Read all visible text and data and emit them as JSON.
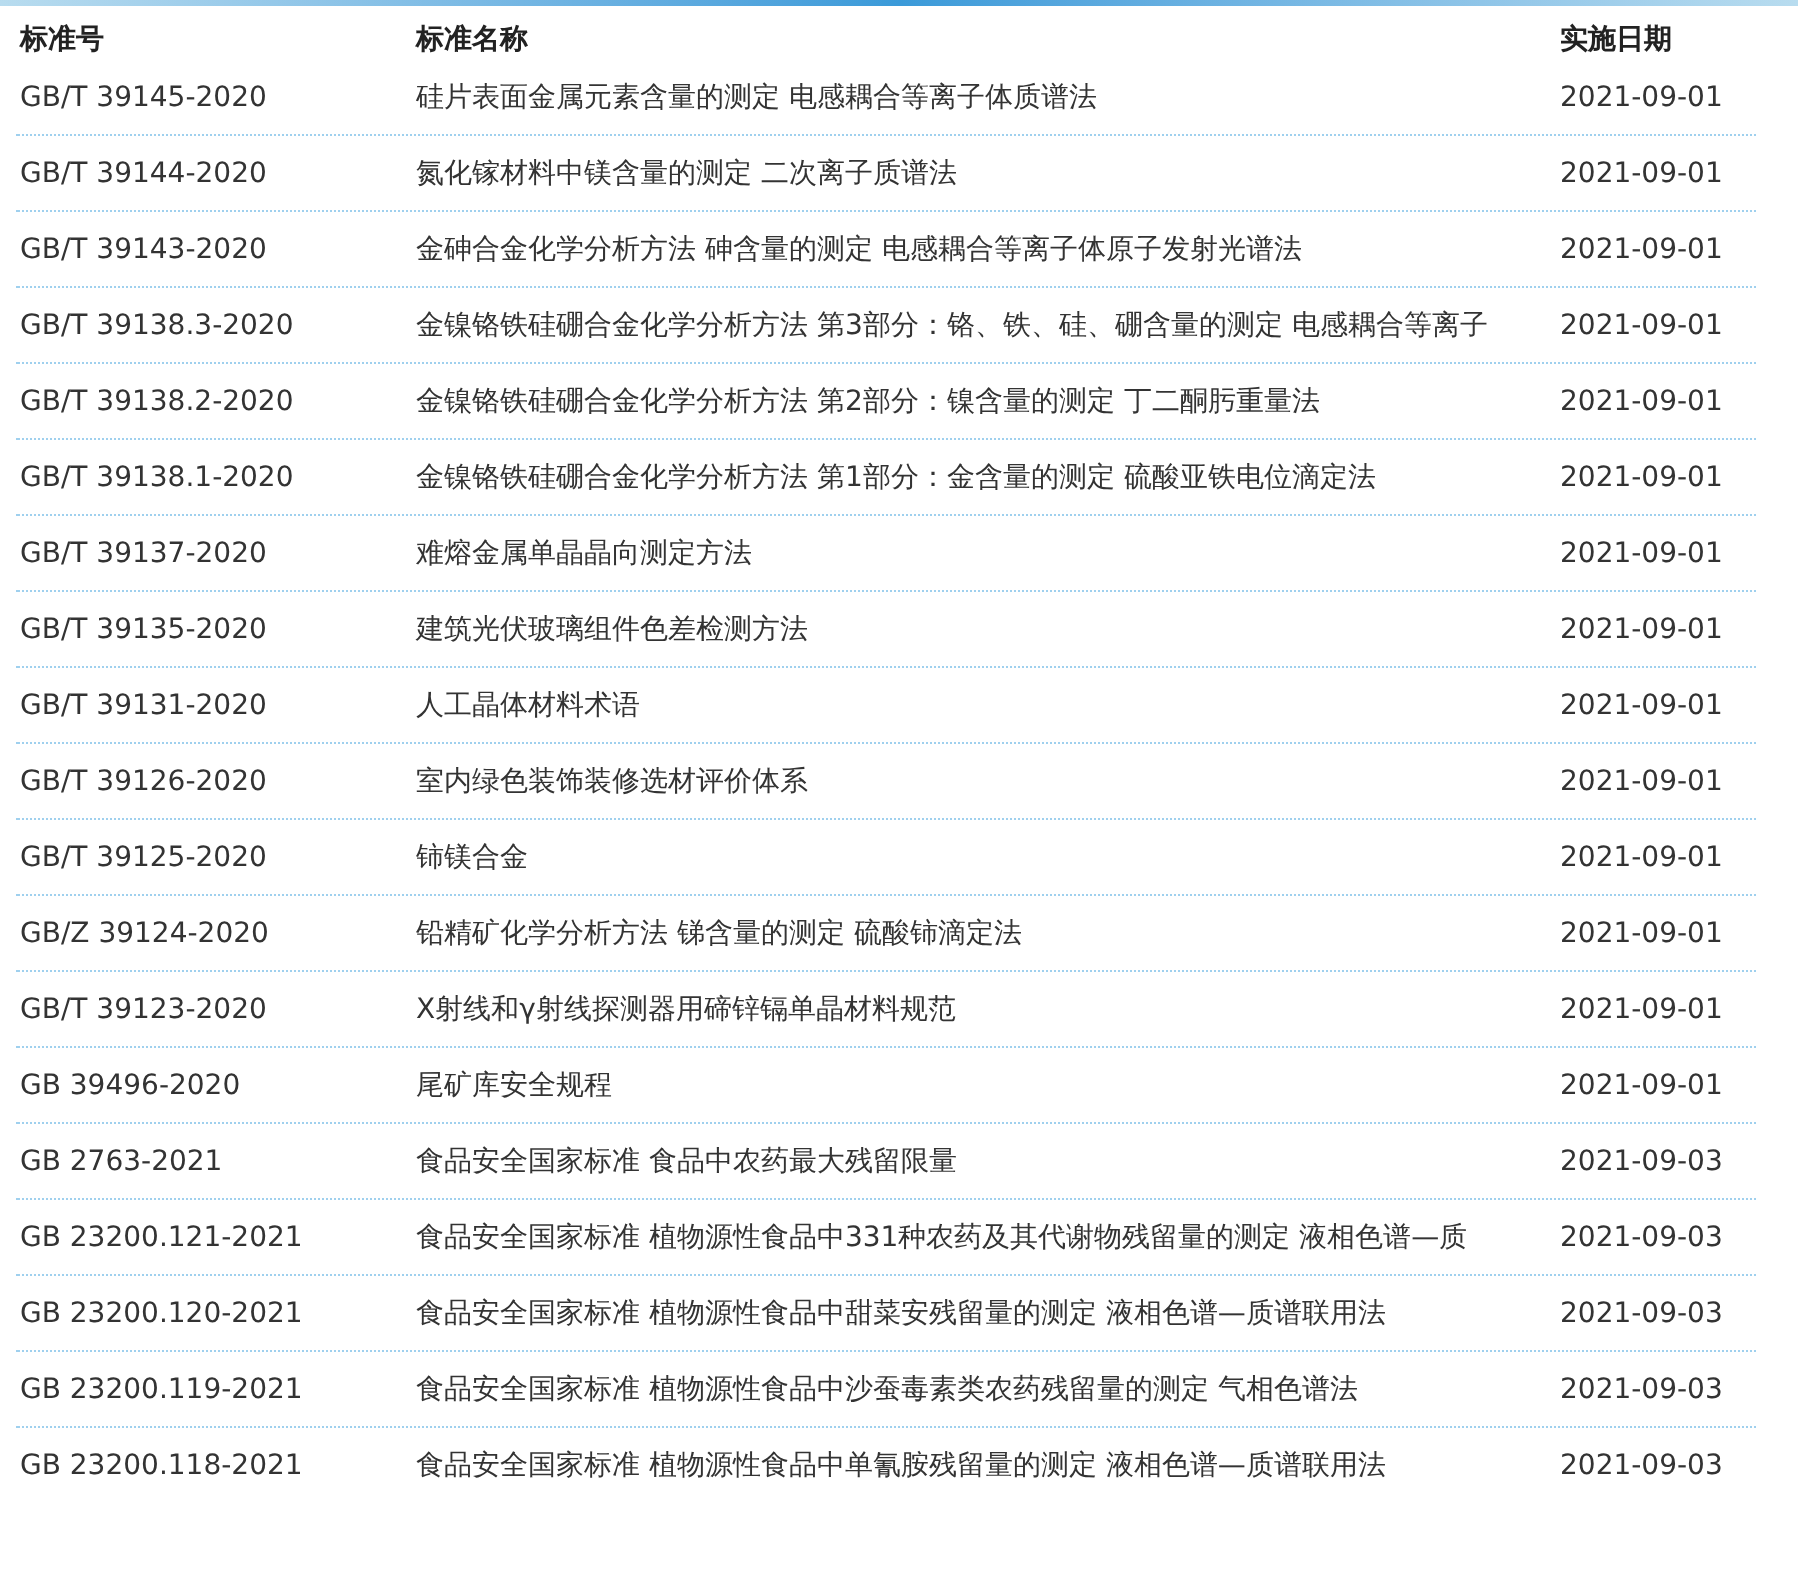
{
  "table": {
    "columns": [
      "标准号",
      "标准名称",
      "实施日期"
    ],
    "rows": [
      {
        "code": "GB/T 39145-2020",
        "name": "硅片表面金属元素含量的测定 电感耦合等离子体质谱法",
        "date": "2021-09-01"
      },
      {
        "code": "GB/T 39144-2020",
        "name": "氮化镓材料中镁含量的测定 二次离子质谱法",
        "date": "2021-09-01"
      },
      {
        "code": "GB/T 39143-2020",
        "name": "金砷合金化学分析方法 砷含量的测定 电感耦合等离子体原子发射光谱法",
        "date": "2021-09-01"
      },
      {
        "code": "GB/T 39138.3-2020",
        "name": "金镍铬铁硅硼合金化学分析方法 第3部分：铬、铁、硅、硼含量的测定 电感耦合等离子",
        "date": "2021-09-01"
      },
      {
        "code": "GB/T 39138.2-2020",
        "name": "金镍铬铁硅硼合金化学分析方法 第2部分：镍含量的测定 丁二酮肟重量法",
        "date": "2021-09-01"
      },
      {
        "code": "GB/T 39138.1-2020",
        "name": "金镍铬铁硅硼合金化学分析方法 第1部分：金含量的测定 硫酸亚铁电位滴定法",
        "date": "2021-09-01"
      },
      {
        "code": "GB/T 39137-2020",
        "name": "难熔金属单晶晶向测定方法",
        "date": "2021-09-01"
      },
      {
        "code": "GB/T 39135-2020",
        "name": "建筑光伏玻璃组件色差检测方法",
        "date": "2021-09-01"
      },
      {
        "code": "GB/T 39131-2020",
        "name": "人工晶体材料术语",
        "date": "2021-09-01"
      },
      {
        "code": "GB/T 39126-2020",
        "name": "室内绿色装饰装修选材评价体系",
        "date": "2021-09-01"
      },
      {
        "code": "GB/T 39125-2020",
        "name": "铈镁合金",
        "date": "2021-09-01"
      },
      {
        "code": "GB/Z 39124-2020",
        "name": "铅精矿化学分析方法 锑含量的测定 硫酸铈滴定法",
        "date": "2021-09-01"
      },
      {
        "code": "GB/T 39123-2020",
        "name": "X射线和γ射线探测器用碲锌镉单晶材料规范",
        "date": "2021-09-01"
      },
      {
        "code": "GB 39496-2020",
        "name": "尾矿库安全规程",
        "date": "2021-09-01"
      },
      {
        "code": "GB 2763-2021",
        "name": "食品安全国家标准 食品中农药最大残留限量",
        "date": "2021-09-03"
      },
      {
        "code": "GB 23200.121-2021",
        "name": "食品安全国家标准 植物源性食品中331种农药及其代谢物残留量的测定 液相色谱—质",
        "date": "2021-09-03"
      },
      {
        "code": "GB 23200.120-2021",
        "name": "食品安全国家标准 植物源性食品中甜菜安残留量的测定 液相色谱—质谱联用法",
        "date": "2021-09-03"
      },
      {
        "code": "GB 23200.119-2021",
        "name": "食品安全国家标准 植物源性食品中沙蚕毒素类农药残留量的测定 气相色谱法",
        "date": "2021-09-03"
      },
      {
        "code": "GB 23200.118-2021",
        "name": "食品安全国家标准 植物源性食品中单氰胺残留量的测定 液相色谱—质谱联用法",
        "date": "2021-09-03"
      }
    ]
  }
}
